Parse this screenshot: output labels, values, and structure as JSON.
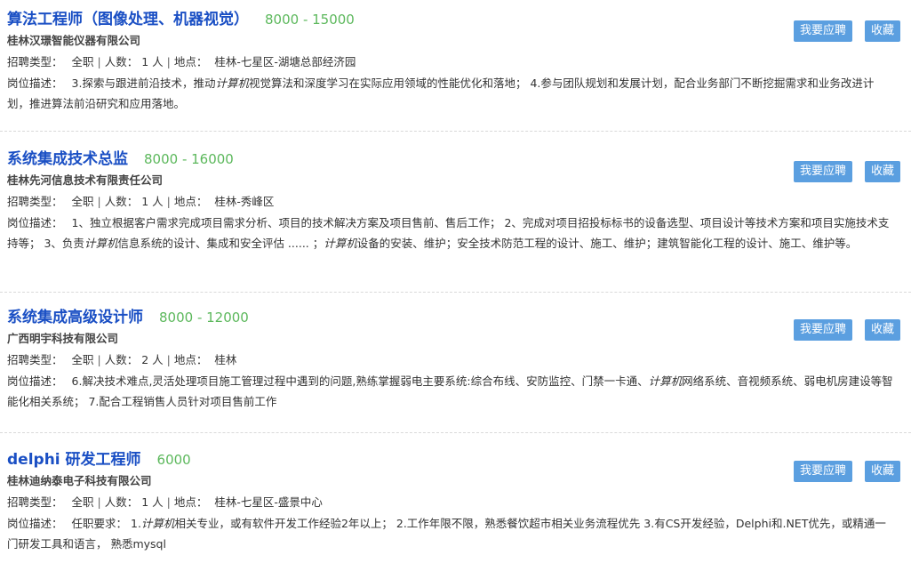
{
  "labels": {
    "type": "招聘类型：",
    "count": "人数：",
    "location": "地点：",
    "desc": "岗位描述：",
    "apply": "我要应聘",
    "favorite": "收藏",
    "sep": "|"
  },
  "jobs": [
    {
      "title": "算法工程师（图像处理、机器视觉）",
      "salary": "8000 - 15000",
      "company": "桂林汉璟智能仪器有限公司",
      "type": "全职",
      "count": "1 人",
      "location": "桂林-七星区-湖塘总部经济园",
      "desc_parts": [
        {
          "text": "3.探索与跟进前沿技术，推动"
        },
        {
          "text": "计算机",
          "em": true
        },
        {
          "text": "视觉算法和深度学习在实际应用领域的性能优化和落地； 4.参与团队规划和发展计划，配合业务部门不断挖掘需求和业务改进计划，推进算法前沿研究和应用落地。"
        }
      ]
    },
    {
      "title": "系统集成技术总监",
      "salary": "8000 - 16000",
      "company": "桂林先河信息技术有限责任公司",
      "type": "全职",
      "count": "1 人",
      "location": "桂林-秀峰区",
      "desc_parts": [
        {
          "text": "1、独立根据客户需求完成项目需求分析、项目的技术解决方案及项目售前、售后工作； 2、完成对项目招投标标书的设备选型、项目设计等技术方案和项目实施技术支持等； 3、负责"
        },
        {
          "text": "计算机",
          "em": true
        },
        {
          "text": "信息系统的设计、集成和安全评估 ...... ；"
        },
        {
          "text": "计算机",
          "em": true
        },
        {
          "text": "设备的安装、维护；安全技术防范工程的设计、施工、维护；建筑智能化工程的设计、施工、维护等。"
        }
      ]
    },
    {
      "title": "系统集成高级设计师",
      "salary": "8000 - 12000",
      "company": "广西明宇科技有限公司",
      "type": "全职",
      "count": "2 人",
      "location": "桂林",
      "desc_parts": [
        {
          "text": "6.解决技术难点,灵活处理项目施工管理过程中遇到的问题,熟练掌握弱电主要系统:综合布线、安防监控、门禁一卡通、"
        },
        {
          "text": "计算机",
          "em": true
        },
        {
          "text": "网络系统、音视频系统、弱电机房建设等智能化相关系统； 7.配合工程销售人员针对项目售前工作"
        }
      ]
    },
    {
      "title": "delphi 研发工程师",
      "salary": "6000",
      "company": "桂林迪纳泰电子科技有限公司",
      "type": "全职",
      "count": "1 人",
      "location": "桂林-七星区-盛景中心",
      "desc_parts": [
        {
          "text": "任职要求： 1."
        },
        {
          "text": "计算机",
          "em": true
        },
        {
          "text": "相关专业，或有软件开发工作经验2年以上； 2.工作年限不限，熟悉餐饮超市相关业务流程优先 3.有CS开发经验，Delphi和.NET优先，或精通一门研发工具和语言， 熟悉mysql"
        }
      ]
    }
  ]
}
